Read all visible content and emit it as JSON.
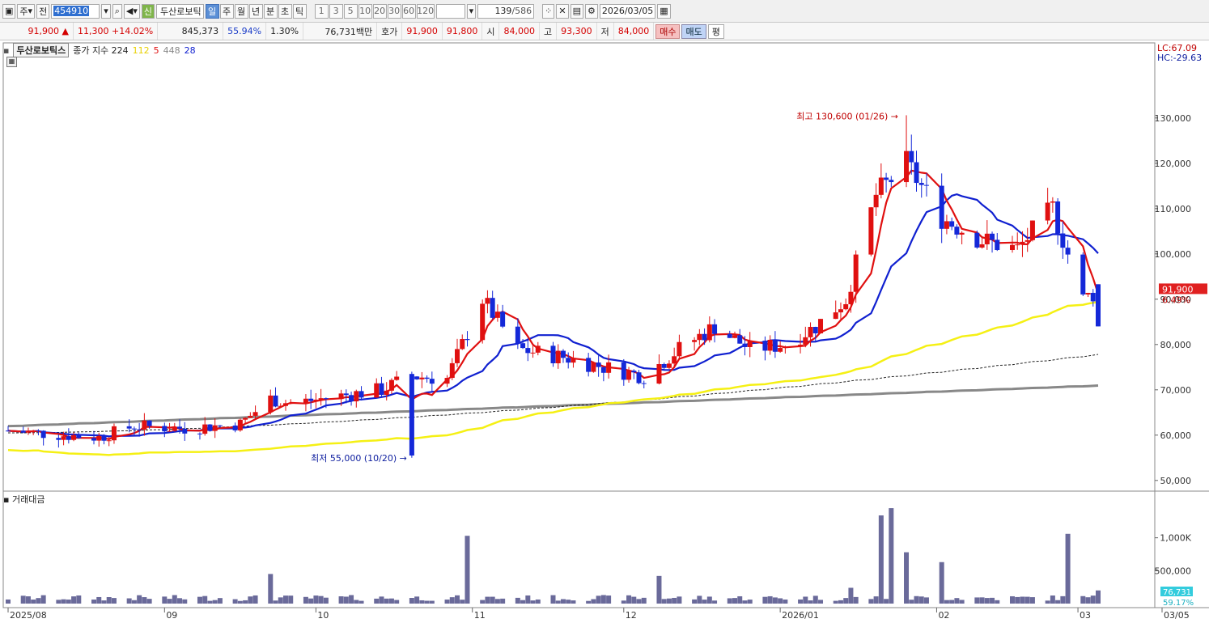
{
  "toolbar": {
    "type_sel": "주",
    "prev": "전",
    "code": "454910",
    "badge": "신",
    "name": "두산로보틱",
    "periods": [
      "일",
      "주",
      "월",
      "년",
      "분",
      "초",
      "틱"
    ],
    "active_period": "일",
    "intervals": [
      "1",
      "3",
      "5",
      "10",
      "20",
      "30",
      "60",
      "120"
    ],
    "count": "139",
    "total": "/586",
    "date": "2026/03/05"
  },
  "quote": {
    "price": "91,900",
    "change": "11,300",
    "change_pct": "+14.02%",
    "volume": "845,373",
    "vol_ratio": "55.94%",
    "turnover_pct": "1.30%",
    "amount": "76,731백만",
    "ask_label": "호가",
    "ask1": "91,900",
    "ask2": "91,800",
    "open_label": "시",
    "open": "84,000",
    "high_label": "고",
    "high": "93,300",
    "low_label": "저",
    "low": "84,000",
    "buy": "매수",
    "sell": "매도",
    "avg": "평"
  },
  "legend": {
    "stock": "두산로보틱스",
    "desc": "종가 지수 224",
    "ma1": "112",
    "ma2": "5",
    "ma3": "448",
    "ma4": "28"
  },
  "colors": {
    "up": "#e01010",
    "down": "#1428d8",
    "ma5": "#e01010",
    "ma28": "#1020d0",
    "ma112": "#f5f014",
    "ma224": "#222222",
    "ma448": "#888888",
    "volume": "#6a6a9a"
  },
  "axis": {
    "lc": "LC:67.09",
    "hc": "HC:-29.63",
    "price_label": "91,900",
    "price_pct": "6.49%",
    "high_note": "최고 130,600 (01/26)",
    "low_note": "최저 55,000 (10/20)",
    "vol_title": "거래대금",
    "vol_label": "76,731",
    "vol_pct": "59.17%"
  },
  "chart_data": {
    "type": "candlestick",
    "y_ticks": [
      "130,000",
      "120,000",
      "110,000",
      "100,000",
      "90,000",
      "80,000",
      "70,000",
      "60,000",
      "50,000"
    ],
    "y_values": [
      130000,
      120000,
      110000,
      100000,
      90000,
      80000,
      70000,
      60000,
      50000
    ],
    "y_range": [
      48000,
      138000
    ],
    "vol_ticks": [
      "1,000K",
      "500,000"
    ],
    "vol_values": [
      1000000,
      500000
    ],
    "vol_range": [
      0,
      1500000
    ],
    "x_labels": [
      "2025/08",
      "09",
      "10",
      "11",
      "12",
      "2026/01",
      "02",
      "03",
      "03/05"
    ],
    "x_label_dates": [
      "2025-08-01",
      "2025-09-01",
      "2025-10-01",
      "2025-11-01",
      "2025-12-01",
      "2026-01-01",
      "2026-02-01",
      "2026-03-01",
      "2026-03-05"
    ],
    "close_trend": [
      [
        "2025-08-01",
        61000
      ],
      [
        "2025-08-12",
        60000
      ],
      [
        "2025-08-19",
        59500
      ],
      [
        "2025-08-26",
        62000
      ],
      [
        "2025-09-05",
        61500
      ],
      [
        "2025-09-16",
        62500
      ],
      [
        "2025-09-22",
        68000
      ],
      [
        "2025-09-26",
        67000
      ],
      [
        "2025-10-02",
        68000
      ],
      [
        "2025-10-14",
        70000
      ],
      [
        "2025-10-20",
        73000
      ],
      [
        "2025-10-27",
        72500
      ],
      [
        "2025-11-03",
        90000
      ],
      [
        "2025-11-10",
        79000
      ],
      [
        "2025-11-20",
        77000
      ],
      [
        "2025-11-27",
        75000
      ],
      [
        "2025-12-05",
        73000
      ],
      [
        "2025-12-12",
        79000
      ],
      [
        "2025-12-19",
        84000
      ],
      [
        "2025-12-26",
        79000
      ],
      [
        "2026-01-02",
        80000
      ],
      [
        "2026-01-08",
        84000
      ],
      [
        "2026-01-14",
        90000
      ],
      [
        "2026-01-20",
        113000
      ],
      [
        "2026-01-26",
        120000
      ],
      [
        "2026-02-02",
        108000
      ],
      [
        "2026-02-10",
        103000
      ],
      [
        "2026-02-17",
        101000
      ],
      [
        "2026-02-24",
        110000
      ],
      [
        "2026-03-02",
        90000
      ],
      [
        "2026-03-05",
        91900
      ]
    ],
    "high_point": {
      "date": "2026-01-26",
      "value": 130600
    },
    "low_point": {
      "date": "2025-10-20",
      "value": 55000
    },
    "volume_peaks": [
      [
        "2025-09-22",
        450000
      ],
      [
        "2025-10-31",
        1030000
      ],
      [
        "2025-12-08",
        420000
      ],
      [
        "2026-01-15",
        240000
      ],
      [
        "2026-01-21",
        1340000
      ],
      [
        "2026-01-23",
        1450000
      ],
      [
        "2026-01-26",
        780000
      ],
      [
        "2026-02-02",
        630000
      ],
      [
        "2026-02-27",
        1060000
      ],
      [
        "2026-03-05",
        200000
      ]
    ]
  }
}
